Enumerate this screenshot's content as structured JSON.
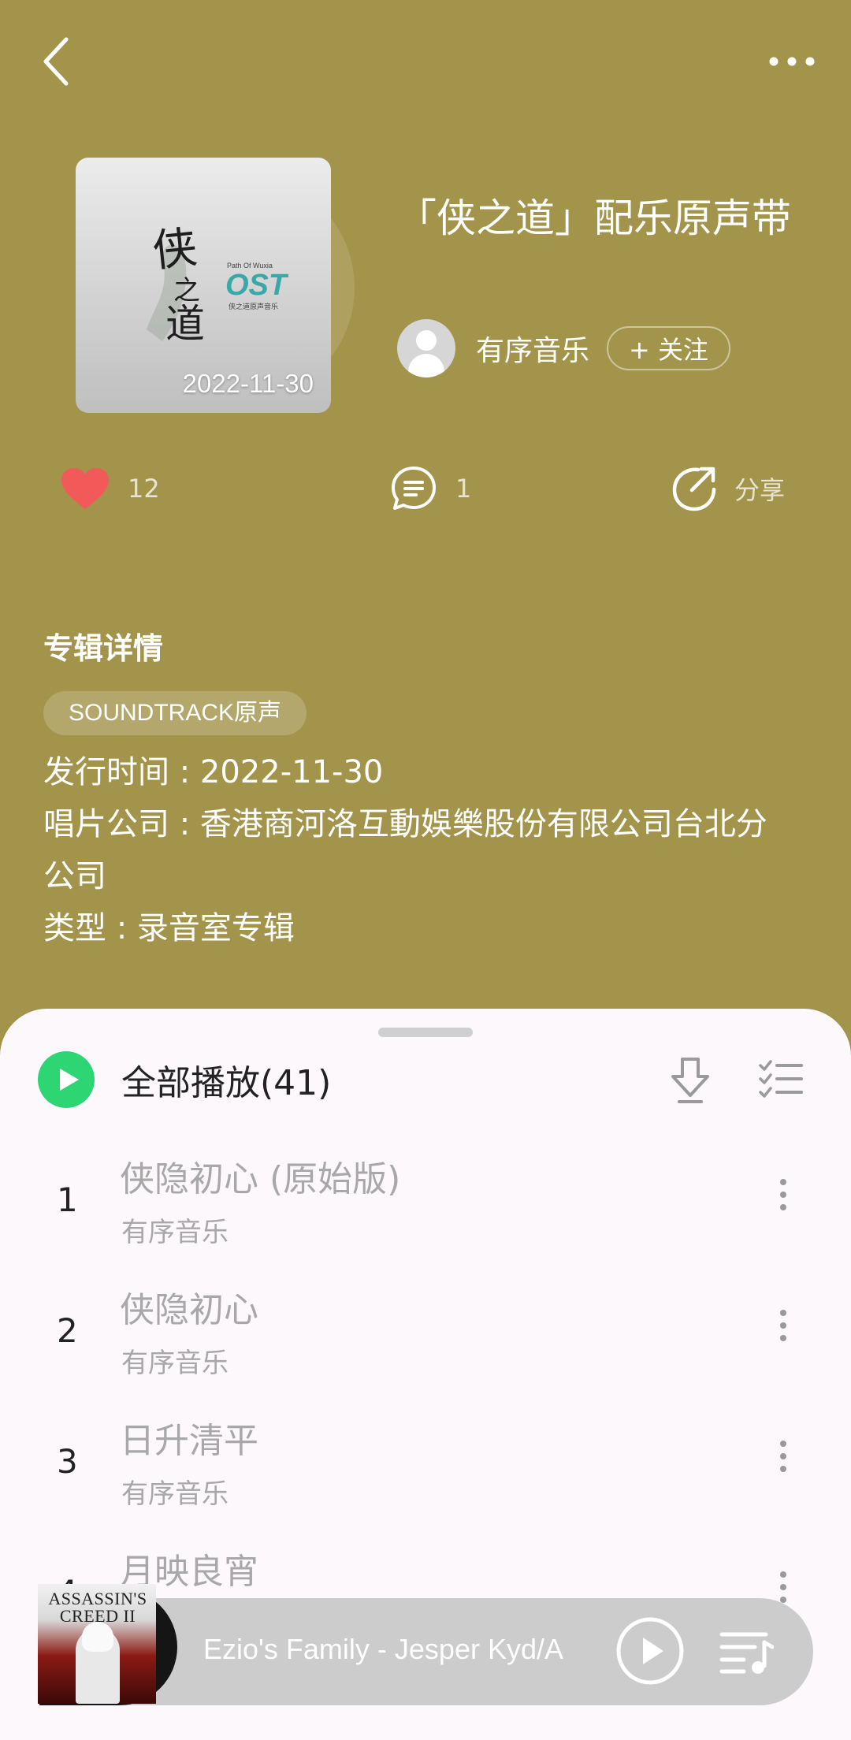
{
  "header": {
    "back_icon": "chevron-left-icon",
    "more_icon": "more-horizontal-icon"
  },
  "album": {
    "cover_date": "2022-11-30",
    "title": "「侠之道」配乐原声带",
    "artist": "有序音乐",
    "follow_label": "+ 关注",
    "cover_text": {
      "title_chars": "侠之道",
      "ost": "OST",
      "path": "Path Of Wuxia",
      "sub": "侠之道原声音乐"
    }
  },
  "actions": {
    "like_count": "12",
    "comment_count": "1",
    "share_label": "分享",
    "like_color": "#f25a5a"
  },
  "details": {
    "title": "专辑详情",
    "tag": "SOUNDTRACK原声",
    "release": "发行时间 : 2022-11-30",
    "label_line1": "唱片公司 : 香港商河洛互動娛樂股份有限公司台北分",
    "label_line2": "公司",
    "type": "类型 : 录音室专辑"
  },
  "tracklist": {
    "play_all_label": "全部播放(41)",
    "accent": "#2ed573",
    "tracks": [
      {
        "num": "1",
        "title": "侠隐初心 (原始版)",
        "artist": "有序音乐"
      },
      {
        "num": "2",
        "title": "侠隐初心",
        "artist": "有序音乐"
      },
      {
        "num": "3",
        "title": "日升清平",
        "artist": "有序音乐"
      },
      {
        "num": "4",
        "title": "月映良宵",
        "artist": ""
      }
    ]
  },
  "mini_player": {
    "now_playing": "Ezio's Family - Jesper Kyd/A",
    "cover_brand_1": "ASSASSIN'S",
    "cover_brand_2": "CREED II"
  },
  "colors": {
    "page_bg": "#a3944b",
    "sheet_bg": "#fcf8fc"
  }
}
